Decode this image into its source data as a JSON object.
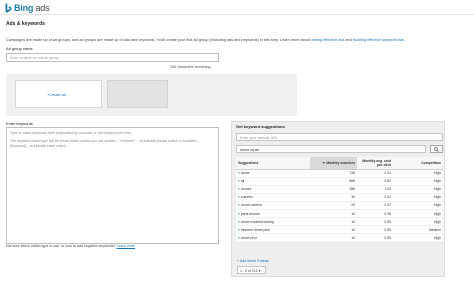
{
  "brand": {
    "name_bold": "Bing",
    "name_light": " ads",
    "color": "#1f7ea8"
  },
  "section": {
    "title": "Ads & keywords"
  },
  "intro": {
    "text": "Campaigns are made up of ad groups, and ad groups are made up of ads and keywords. You'll create your first ad group (including ads and keywords) in this step. Learn more about ",
    "link1": "writing effective ads",
    "and": " and ",
    "link2": "building effective keyword lists",
    "end": "."
  },
  "ad_group": {
    "label": "Ad group name",
    "placeholder": "Enter a name for this ad group",
    "chars_remaining": "256 characters remaining"
  },
  "ads": {
    "create_label": "+Create ad"
  },
  "keywords": {
    "label": "Enter keywords",
    "placeholder_line1": "Type or paste keywords here (separated by commas, or one keyword per line).",
    "placeholder_line2": "The keyword match type will be broad match unless you use quotes -- \"Keyword\" -- to indicate phrase match or brackets -- [Keyword] -- to indicate exact match.",
    "help_text": "Not sure which match type to use, or how to add negative keywords? ",
    "help_link": "Learn more"
  },
  "suggestions": {
    "title": "Get keyword suggestions",
    "url_placeholder": "Enter your website URL",
    "search_value": "drone repair",
    "columns": [
      "Suggestions",
      "Monthly searches",
      "Monthly avg. cost per click",
      "Competition"
    ],
    "rows": [
      {
        "keyword": "drone",
        "searches": "746",
        "cpc": "0.31",
        "competition": "High"
      },
      {
        "keyword": "dji",
        "searches": "666",
        "cpc": "0.82",
        "competition": "High"
      },
      {
        "keyword": "drones",
        "searches": "386",
        "cpc": "1.00",
        "competition": "High"
      },
      {
        "keyword": "zumeric",
        "searches": "30",
        "cpc": "0.51",
        "competition": "High"
      },
      {
        "keyword": "drone camera",
        "searches": "20",
        "cpc": "0.47",
        "competition": "High"
      },
      {
        "keyword": "parts drones",
        "searches": "10",
        "cpc": "0.06",
        "competition": "High"
      },
      {
        "keyword": "drone troubleshooting",
        "searches": "10",
        "cpc": "0.50",
        "competition": "High"
      },
      {
        "keyword": "become drone pilot",
        "searches": "10",
        "cpc": "0.50",
        "competition": "Medium"
      },
      {
        "keyword": "drone pilot",
        "searches": "10",
        "cpc": "0.50",
        "competition": "High"
      }
    ],
    "add_all": "+ Add these 9 ideas",
    "pager": "1 - 9 of 212"
  }
}
